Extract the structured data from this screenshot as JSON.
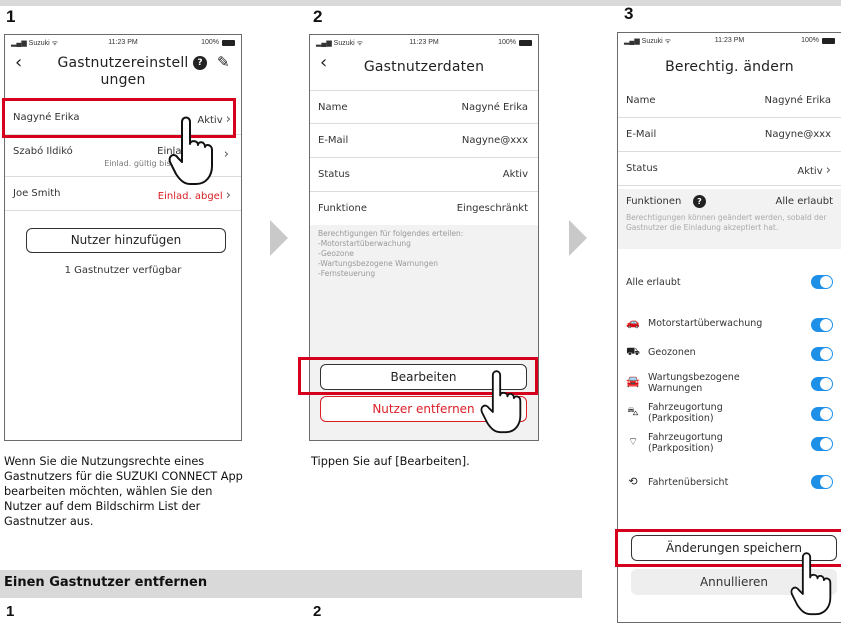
{
  "steps": {
    "s1": "1",
    "s2": "2",
    "s3": "3"
  },
  "status_bar": {
    "carrier": "Suzuki",
    "time": "11:23 PM",
    "battery": "100%"
  },
  "screen1": {
    "title_line1": "Gastnutzereinstell",
    "title_line2": "ungen",
    "users": [
      {
        "name": "Nagyné Erika",
        "status": "Aktiv"
      },
      {
        "name": "Szabó Ildikó",
        "status": "Einlad.",
        "sub": "Einlad. gültig bis 23.0"
      },
      {
        "name": "Joe Smith",
        "status": "Einlad. abgel"
      }
    ],
    "add_button": "Nutzer hinzufügen",
    "available": "1 Gastnutzer verfügbar"
  },
  "screen2": {
    "title": "Gastnutzerdaten",
    "rows": [
      {
        "label": "Name",
        "value": "Nagyné Erika"
      },
      {
        "label": "E-Mail",
        "value": "Nagyne@xxx"
      },
      {
        "label": "Status",
        "value": "Aktiv"
      },
      {
        "label": "Funktione",
        "value": "Eingeschränkt"
      }
    ],
    "perm_text": "Berechtigungen für folgendes erteilen:\n-Motorstartüberwachung\n-Geozone\n-Wartungsbezogene Warnungen\n-Fernsteuerung",
    "edit_button": "Bearbeiten",
    "remove_button": "Nutzer entfernen"
  },
  "screen3": {
    "title": "Berechtig. ändern",
    "rows": [
      {
        "label": "Name",
        "value": "Nagyné Erika"
      },
      {
        "label": "E-Mail",
        "value": "Nagyne@xxx"
      },
      {
        "label": "Status",
        "value": "Aktiv"
      }
    ],
    "functions_label": "Funktionen",
    "functions_value": "Alle erlaubt",
    "functions_note": "Berechtigungen können geändert werden, sobald der Gastnutzer die Einladung akzeptiert hat.",
    "all_allowed": "Alle erlaubt",
    "features": [
      {
        "label": "Motorstartüberwachung",
        "icon": "car-engine-icon"
      },
      {
        "label": "Geozonen",
        "icon": "geozone-icon"
      },
      {
        "label": "Wartungsbezogene Warnungen",
        "icon": "maintenance-car-icon"
      },
      {
        "label": "Fahrzeugortung (Parkposition)",
        "icon": "parking-location-icon"
      },
      {
        "label": "Fahrzeugortung (Parkposition)",
        "icon": "signal-icon"
      },
      {
        "label": "Fahrtenübersicht",
        "icon": "trip-history-icon"
      }
    ],
    "save_button": "Änderungen speichern",
    "cancel_button": "Annullieren"
  },
  "captions": {
    "c1": "Wenn Sie die Nutzungsrechte eines Gastnutzers für die SUZUKI CONNECT App bearbeiten möchten, wählen Sie den Nutzer auf dem Bildschirm List der Gastnutzer aus.",
    "c2": "Tippen Sie auf [Bearbeiten]."
  },
  "section": {
    "title": "Einen Gastnutzer entfernen",
    "s1": "1",
    "s2": "2"
  },
  "colors": {
    "highlight": "#d6001c",
    "toggle": "#1e90e8",
    "warning_text": "#d92027"
  }
}
